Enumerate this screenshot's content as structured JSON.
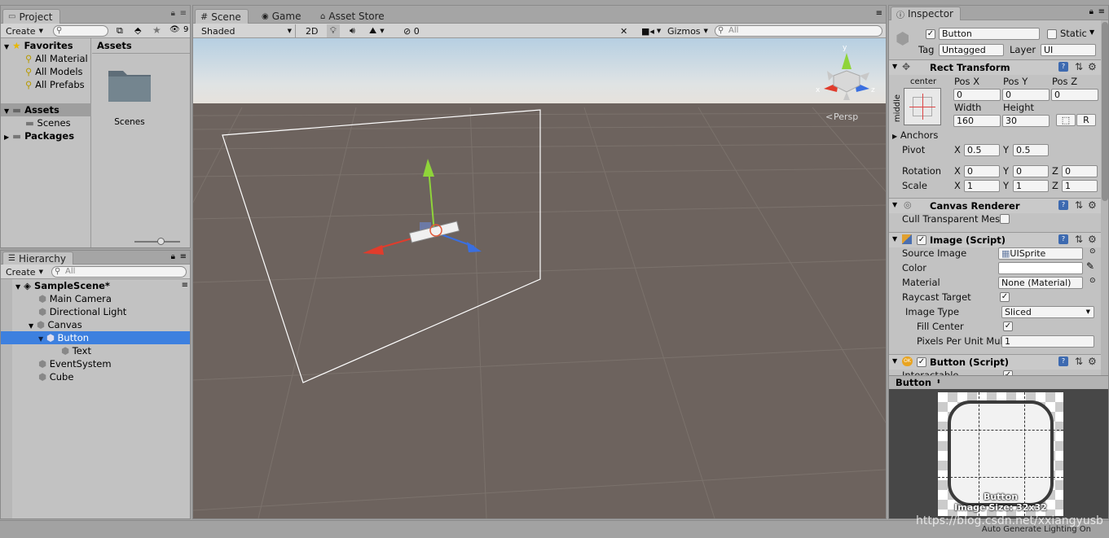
{
  "colors": {
    "panel_bg": "#c2c2c2",
    "selection": "#3d80df",
    "scene_ground": "#6d635e",
    "sky_top": "#b4cde1",
    "axis_x": "#e03c2c",
    "axis_y": "#8fd43a",
    "axis_z": "#3a6fe0"
  },
  "project": {
    "tab_label": "Project",
    "create_label": "Create",
    "hidden_count": "9",
    "favorites_label": "Favorites",
    "favorites": [
      "All Material",
      "All Models",
      "All Prefabs"
    ],
    "assets_label": "Assets",
    "scenes_label": "Scenes",
    "packages_label": "Packages",
    "breadcrumb": "Assets",
    "folder_name": "Scenes"
  },
  "hierarchy": {
    "tab_label": "Hierarchy",
    "create_label": "Create",
    "search_placeholder": "All",
    "scene_name": "SampleScene*",
    "items": [
      "Main Camera",
      "Directional Light",
      "Canvas",
      "Button",
      "Text",
      "EventSystem",
      "Cube"
    ]
  },
  "scene": {
    "tabs": [
      "Scene",
      "Game",
      "Asset Store"
    ],
    "shading": "Shaded",
    "mode_2d": "2D",
    "hidden_count": "0",
    "gizmos_label": "Gizmos",
    "search_placeholder": "All",
    "persp_label": "Persp",
    "gizmo_axes": [
      "y",
      "x",
      "z"
    ]
  },
  "inspector": {
    "tab_label": "Inspector",
    "object_name": "Button",
    "static_label": "Static",
    "tag_label": "Tag",
    "tag_value": "Untagged",
    "layer_label": "Layer",
    "layer_value": "UI",
    "rect_transform": {
      "title": "Rect Transform",
      "anchor_h": "center",
      "anchor_v": "middle",
      "pos_x_label": "Pos X",
      "pos_y_label": "Pos Y",
      "pos_z_label": "Pos Z",
      "pos_x": "0",
      "pos_y": "0",
      "pos_z": "0",
      "width_label": "Width",
      "height_label": "Height",
      "width": "160",
      "height": "30",
      "r_label": "R",
      "anchors_label": "Anchors",
      "pivot_label": "Pivot",
      "pivot_x": "0.5",
      "pivot_y": "0.5",
      "rotation_label": "Rotation",
      "rot_x": "0",
      "rot_y": "0",
      "rot_z": "0",
      "scale_label": "Scale",
      "scale_x": "1",
      "scale_y": "1",
      "scale_z": "1",
      "x": "X",
      "y": "Y",
      "z": "Z"
    },
    "canvas_renderer": {
      "title": "Canvas Renderer",
      "cull_label": "Cull Transparent Mes"
    },
    "image": {
      "title": "Image (Script)",
      "source_label": "Source Image",
      "source_value": "UISprite",
      "color_label": "Color",
      "material_label": "Material",
      "material_value": "None (Material)",
      "raycast_label": "Raycast Target",
      "type_label": "Image Type",
      "type_value": "Sliced",
      "fill_label": "Fill Center",
      "ppu_label": "Pixels Per Unit Mul",
      "ppu_value": "1"
    },
    "button": {
      "title": "Button (Script)",
      "interactable_label": "Interactable"
    },
    "preview": {
      "header": "Button",
      "name": "Button",
      "size": "Image Size: 32x32"
    }
  },
  "footer": {
    "auto_lighting": "Auto Generate Lighting On",
    "watermark": "https://blog.csdn.net/xxiangyusb"
  }
}
